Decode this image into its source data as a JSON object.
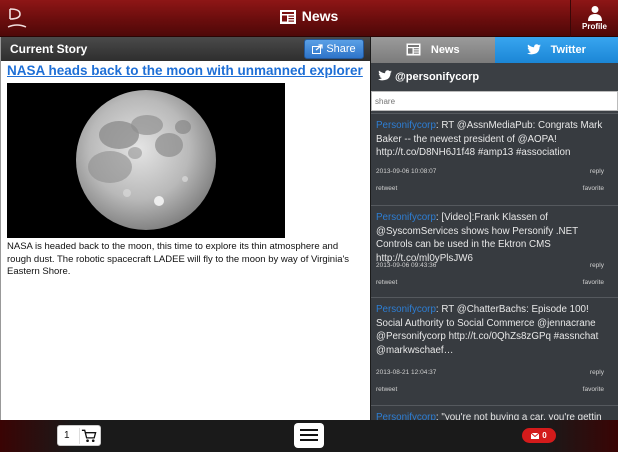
{
  "header": {
    "title": "News",
    "profile_label": "Profile"
  },
  "story": {
    "section_label": "Current Story",
    "share_label": "Share",
    "title": "NASA heads back to the moon with unmanned explorer",
    "body": "NASA is headed back to the moon, this time to explore its thin atmosphere and rough dust. The robotic spacecraft LADEE will fly to the moon by way of Virginia's Eastern Shore."
  },
  "social": {
    "tabs": [
      {
        "label": "News"
      },
      {
        "label": "Twitter"
      }
    ],
    "handle": "@personifycorp",
    "share_placeholder": "share",
    "tweets": [
      {
        "author": "Personifycorp",
        "text": ": RT @AssnMediaPub: Congrats Mark Baker -- the newest president of @AOPA! http://t.co/D8NH6J1f48 #amp13 #association",
        "date": "2013-09-06 10:08:07",
        "reply": "reply",
        "retweet": "retweet",
        "favorite": "favorite"
      },
      {
        "author": "Personifycorp",
        "text": ": [Video]:Frank Klassen of @SyscomServices shows how Personify .NET Controls can be used in the Ektron CMS http://t.co/ml0yPlsJW6",
        "date": "2013-09-06 09:43:36",
        "reply": "reply",
        "retweet": "retweet",
        "favorite": "favorite"
      },
      {
        "author": "Personifycorp",
        "text": ": RT @ChatterBachs: Episode 100! Social Authority to Social Commerce @jennacrane @Personifycorp http://t.co/0QhZs8zGPq #assnchat @markwschaef…",
        "date": "2013-08-21 12:04:37",
        "reply": "reply",
        "retweet": "retweet",
        "favorite": "favorite"
      },
      {
        "author": "Personifycorp",
        "text": ": \"you're not buying a car, you're gettin",
        "date": "",
        "reply": "",
        "retweet": "",
        "favorite": ""
      }
    ]
  },
  "footer": {
    "cart_count": "1",
    "notification_count": "0"
  },
  "colors": {
    "brand_red": "#7a1010",
    "link_blue": "#1e6fd6",
    "twitter_blue": "#2a96e4"
  }
}
